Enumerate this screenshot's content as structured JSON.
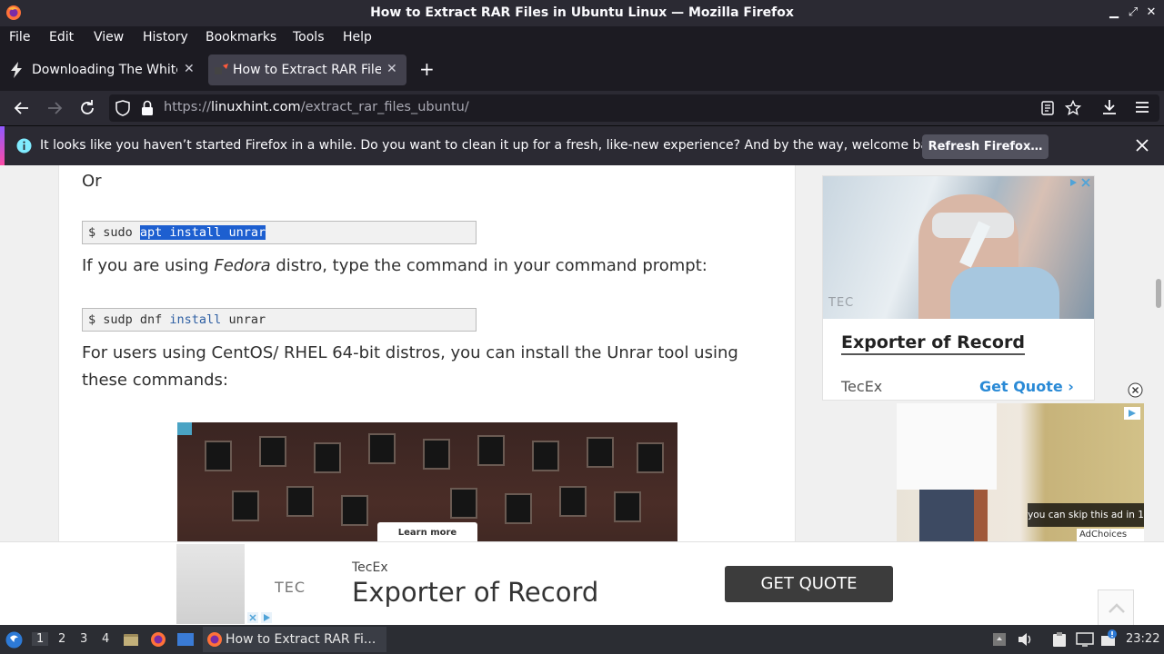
{
  "window": {
    "title": "How to Extract RAR Files in Ubuntu Linux — Mozilla Firefox",
    "minimize": "▁",
    "maximize": "⤢",
    "close": "✕"
  },
  "menu": [
    "File",
    "Edit",
    "View",
    "History",
    "Bookmarks",
    "Tools",
    "Help"
  ],
  "tabs": [
    {
      "label": "Downloading The White",
      "active": false,
      "icon": "bolt-icon"
    },
    {
      "label": "How to Extract RAR Files",
      "active": true,
      "icon": "linuxhint-icon"
    }
  ],
  "new_tab": "+",
  "url": {
    "prefix": "https://",
    "domain": "linuxhint.com",
    "path": "/extract_rar_files_ubuntu/"
  },
  "notification": {
    "message": "It looks like you haven’t started Firefox in a while. Do you want to clean it up for a fresh, like-new experience? And by the way, welcome back!",
    "button": "Refresh Firefox…"
  },
  "article": {
    "or_text": "Or",
    "code1": {
      "prompt": "$ sudo ",
      "selected": "apt install unrar"
    },
    "fedora_para": {
      "before": "If you are using ",
      "em": "Fedora",
      "after": " distro, type the command in your command prompt:"
    },
    "code2": {
      "prompt": "$ sudp dnf ",
      "kw": "install",
      "rest": " unrar"
    },
    "centos_para_line1": "For users using CentOS/ RHEL 64-bit distros, you can install the Unrar tool using",
    "centos_para_line2": "these commands:",
    "video_learn_more": "Learn more"
  },
  "ad_side": {
    "headline": "Exporter of Record",
    "brand": "TecEx",
    "cta": "Get Quote",
    "logo": "TEC"
  },
  "ad_video": {
    "skip_text": "you can skip this ad in 1",
    "adchoices": "AdChoices"
  },
  "banner": {
    "brand": "TecEx",
    "headline": "Exporter of Record",
    "cta": "GET QUOTE",
    "logo": "TEC"
  },
  "taskbar": {
    "workspaces": [
      "1",
      "2",
      "3",
      "4"
    ],
    "active_workspace": "1",
    "app_label": "How to Extract RAR Fi...",
    "clock": "23:22"
  }
}
